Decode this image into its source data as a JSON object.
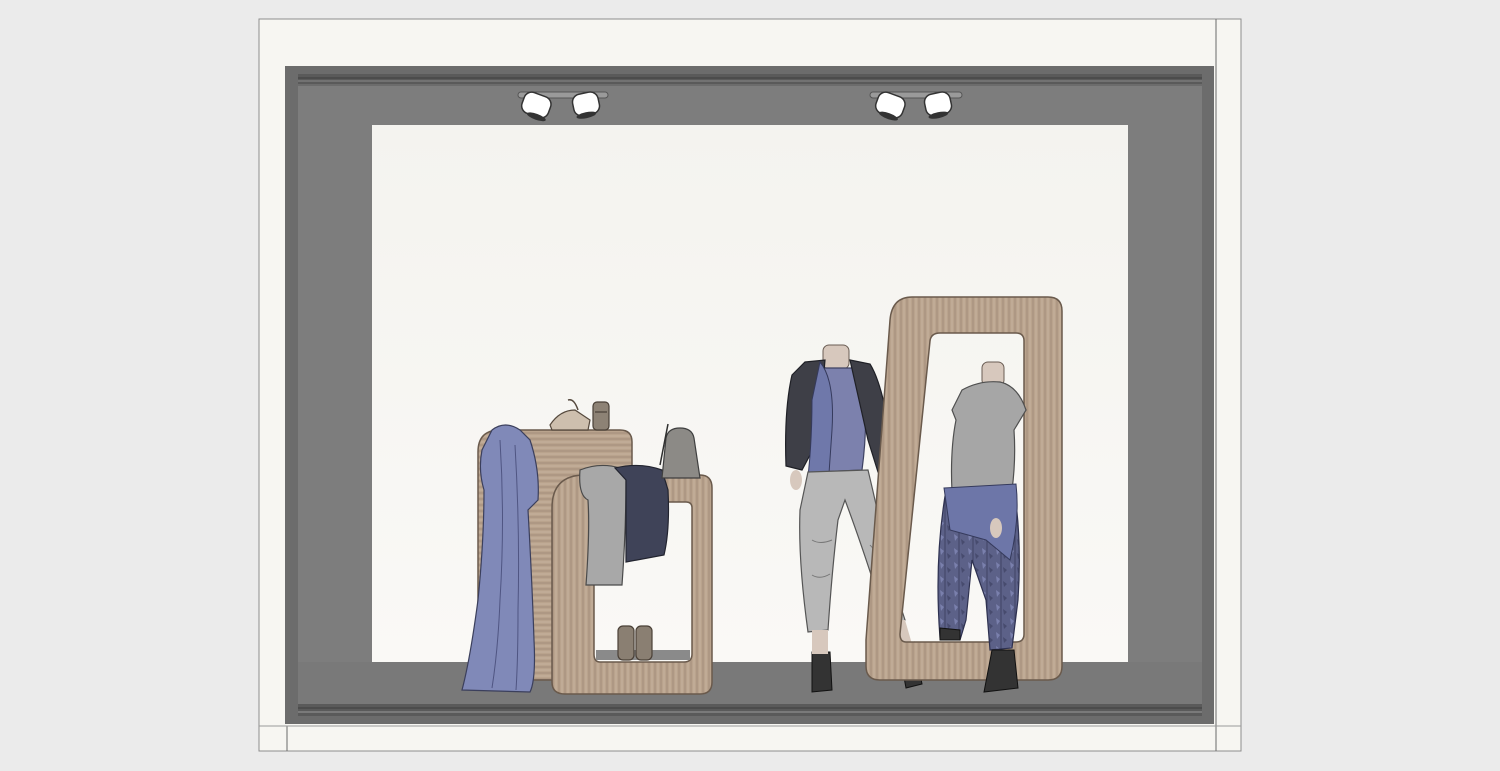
{
  "scene": {
    "view": "storefront-window-elevation",
    "colors": {
      "background": "#ebebeb",
      "wall": "#f6f5f1",
      "frame": "#6f6f6f",
      "frame_dark": "#4a4a4a",
      "backdrop": "#f7f6f2",
      "floor": "#7b7b7b",
      "wood": "#b7a08a",
      "wood_dark": "#8c7968",
      "fabric_blue": "#7f86b4",
      "fabric_grey": "#a9a9a9",
      "jacket": "#4a4a4a",
      "lamp": "#ffffff"
    },
    "objects": [
      {
        "name": "spotlight",
        "icon": "spotlight-icon",
        "count": 2
      },
      {
        "name": "display-stand-left",
        "items": [
          "dress",
          "scarves",
          "jacket",
          "sandals",
          "handbag",
          "shoes"
        ]
      },
      {
        "name": "mannequin-left",
        "items": [
          "cropped-jacket",
          "scarf",
          "top",
          "jogger-pants",
          "boots"
        ]
      },
      {
        "name": "frame-mirror",
        "items": [
          "wooden-frame"
        ]
      },
      {
        "name": "mannequin-right",
        "items": [
          "t-shirt",
          "patterned-pants",
          "boots"
        ]
      }
    ]
  }
}
